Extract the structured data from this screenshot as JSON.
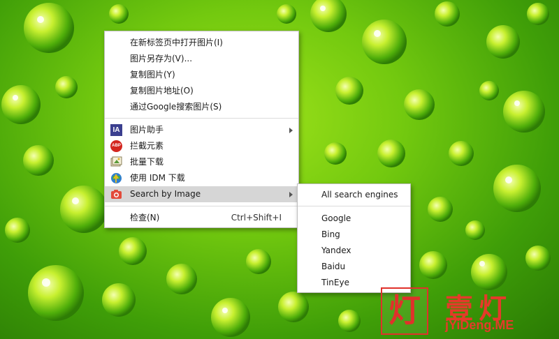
{
  "context_menu": {
    "items": [
      {
        "label": "在新标签页中打开图片(I)"
      },
      {
        "label": "图片另存为(V)..."
      },
      {
        "label": "复制图片(Y)"
      },
      {
        "label": "复制图片地址(O)"
      },
      {
        "label": "通过Google搜索图片(S)"
      },
      {
        "label": "图片助手",
        "icon": "ia-icon",
        "icon_text": "IA"
      },
      {
        "label": "拦截元素",
        "icon": "abp-icon",
        "icon_text": "ABP"
      },
      {
        "label": "批量下载",
        "icon": "image-batch-icon"
      },
      {
        "label": "使用 IDM 下载",
        "icon": "idm-globe-icon"
      },
      {
        "label": "Search by Image",
        "icon": "camera-icon"
      },
      {
        "label": "检查(N)",
        "shortcut": "Ctrl+Shift+I"
      }
    ]
  },
  "submenu": {
    "items": [
      {
        "label": "All search engines"
      },
      {
        "label": "Google"
      },
      {
        "label": "Bing"
      },
      {
        "label": "Yandex"
      },
      {
        "label": "Baidu"
      },
      {
        "label": "TinEye"
      }
    ]
  },
  "watermark": {
    "box_char": "灯",
    "big_text": "壹灯",
    "small_text": "jYiDeng.ME"
  },
  "colors": {
    "highlight": "#d6d6d6",
    "abp_red": "#d3261f",
    "ia_blue": "#3b3f8f",
    "camera_red": "#e24b3b",
    "watermark_red": "#e53a2a"
  }
}
